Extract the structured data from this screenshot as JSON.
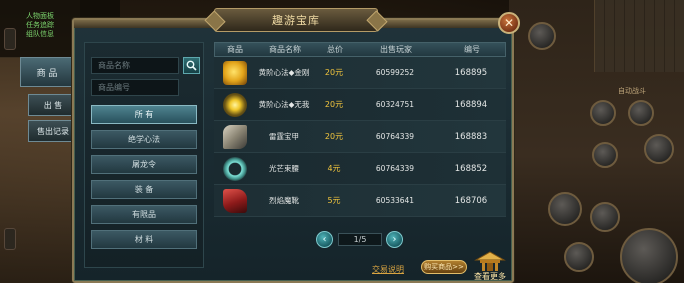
{
  "window": {
    "title": "趣游宝库",
    "close_icon": "close-icon"
  },
  "left_tabs": {
    "goods": "商 品",
    "sell": "出 售",
    "sell_record": "售出记录"
  },
  "search": {
    "name_placeholder": "商品名称",
    "code_placeholder": "商品编号",
    "search_icon": "search-icon"
  },
  "categories": [
    {
      "label": "所 有",
      "active": true
    },
    {
      "label": "绝学心法",
      "active": false
    },
    {
      "label": "屠龙令",
      "active": false
    },
    {
      "label": "装 备",
      "active": false
    },
    {
      "label": "有限品",
      "active": false
    },
    {
      "label": "材 料",
      "active": false
    }
  ],
  "table": {
    "headers": [
      "商品",
      "商品名称",
      "总价",
      "出售玩家",
      "编号"
    ],
    "rows": [
      {
        "icon": "gold-scroll-icon",
        "name": "黄阶心法◆金刚",
        "price": "20元",
        "seller": "60599252",
        "code": "168895"
      },
      {
        "icon": "sun-orb-icon",
        "name": "黄阶心法◆无我",
        "price": "20元",
        "seller": "60324751",
        "code": "168894"
      },
      {
        "icon": "armor-icon",
        "name": "雷霆宝甲",
        "price": "20元",
        "seller": "60764339",
        "code": "168883"
      },
      {
        "icon": "belt-icon",
        "name": "光芒束腰",
        "price": "4元",
        "seller": "60764339",
        "code": "168852"
      },
      {
        "icon": "flame-armor-icon",
        "name": "烈焰魔靴",
        "price": "5元",
        "seller": "60533641",
        "code": "168706"
      }
    ]
  },
  "pager": {
    "text": "1/5",
    "prev_icon": "chevron-left-icon",
    "next_icon": "chevron-right-icon"
  },
  "footer": {
    "help_link": "交易说明",
    "buy_button": "购买商品>>",
    "more_label": "查看更多"
  },
  "background": {
    "topleft_lines": [
      "人物面板",
      "任务追踪",
      "组队信息"
    ],
    "right_label": "自动战斗"
  }
}
